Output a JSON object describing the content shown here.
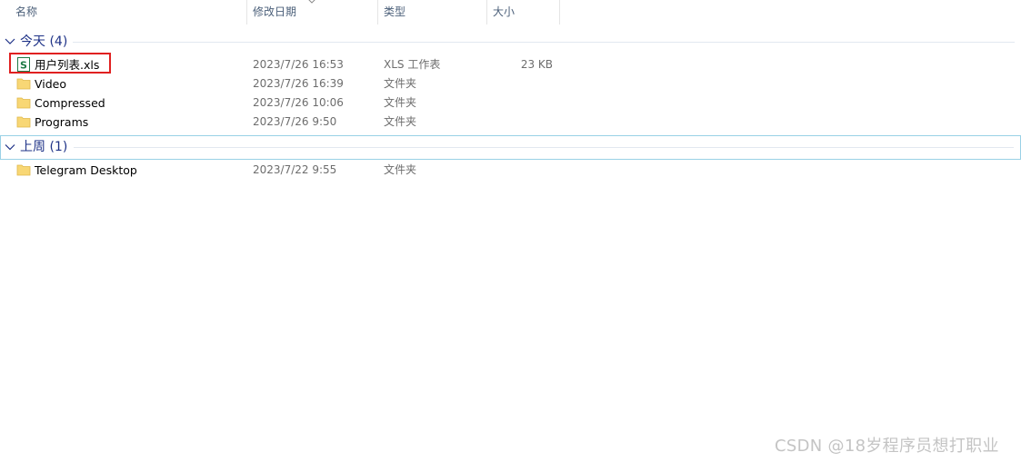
{
  "columns": {
    "name": "名称",
    "modified": "修改日期",
    "type": "类型",
    "size": "大小"
  },
  "sort": {
    "column": "modified",
    "direction": "descending"
  },
  "groups": [
    {
      "label": "今天 (4)",
      "expanded": true,
      "items": [
        {
          "name": "用户列表.xls",
          "modified": "2023/7/26 16:53",
          "type": "XLS 工作表",
          "size": "23 KB",
          "icon": "spreadsheet-icon",
          "highlighted": true
        },
        {
          "name": "Video",
          "modified": "2023/7/26 16:39",
          "type": "文件夹",
          "size": "",
          "icon": "folder-icon"
        },
        {
          "name": "Compressed",
          "modified": "2023/7/26 10:06",
          "type": "文件夹",
          "size": "",
          "icon": "folder-icon"
        },
        {
          "name": "Programs",
          "modified": "2023/7/26 9:50",
          "type": "文件夹",
          "size": "",
          "icon": "folder-icon"
        }
      ]
    },
    {
      "label": "上周 (1)",
      "expanded": true,
      "selected": true,
      "items": [
        {
          "name": "Telegram Desktop",
          "modified": "2023/7/22 9:55",
          "type": "文件夹",
          "size": "",
          "icon": "folder-icon"
        }
      ]
    }
  ],
  "colors": {
    "header_text": "#4c607a",
    "group_text": "#1e3287",
    "detail_text": "#6d6d6d",
    "folder_yellow": "#f8d775",
    "xls_green": "#1f7a45",
    "highlight_red": "#e02020",
    "selected_border": "#99d1e6"
  },
  "watermark": "CSDN @18岁程序员想打职业"
}
